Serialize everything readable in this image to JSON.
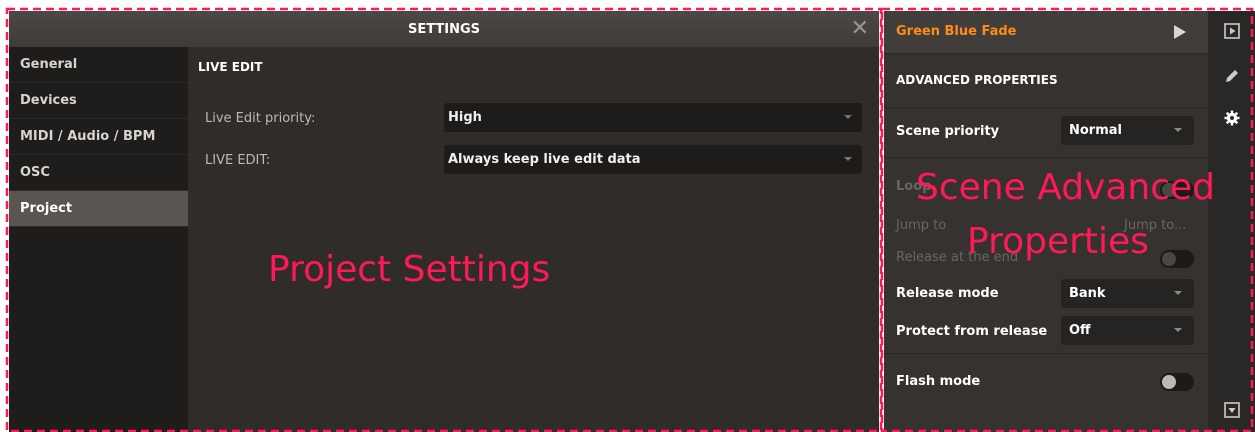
{
  "settings": {
    "title": "SETTINGS",
    "close_glyph": "✕",
    "nav": [
      {
        "label": "General"
      },
      {
        "label": "Devices"
      },
      {
        "label": "MIDI / Audio / BPM"
      },
      {
        "label": "OSC"
      },
      {
        "label": "Project",
        "active": true
      }
    ],
    "section_title": "LIVE EDIT",
    "rows": [
      {
        "label": "Live Edit priority:",
        "value": "High"
      },
      {
        "label": "LIVE EDIT:",
        "value": "Always keep live edit data"
      }
    ]
  },
  "scene_panel": {
    "scene_name": "Green Blue Fade",
    "advanced_title": "ADVANCED PROPERTIES",
    "scene_priority_label": "Scene priority",
    "scene_priority_value": "Normal",
    "loop_label": "Loop",
    "jump_to_label": "Jump to",
    "jump_to_value": "Jump to...",
    "release_at_end_label": "Release at the end",
    "release_mode_label": "Release mode",
    "release_mode_value": "Bank",
    "protect_label": "Protect from release",
    "protect_value": "Off",
    "flash_mode_label": "Flash mode"
  },
  "icon_strip": [
    "play-box-icon",
    "pencil-icon",
    "gear-icon",
    "download-box-icon"
  ],
  "annotations": {
    "left": "Project Settings",
    "right_line1": "Scene Advanced",
    "right_line2": "Properties"
  },
  "colors": {
    "accent_orange": "#ff8c1a",
    "annotation_pink": "#ff1a55",
    "panel_dark": "#2f2c2a"
  }
}
